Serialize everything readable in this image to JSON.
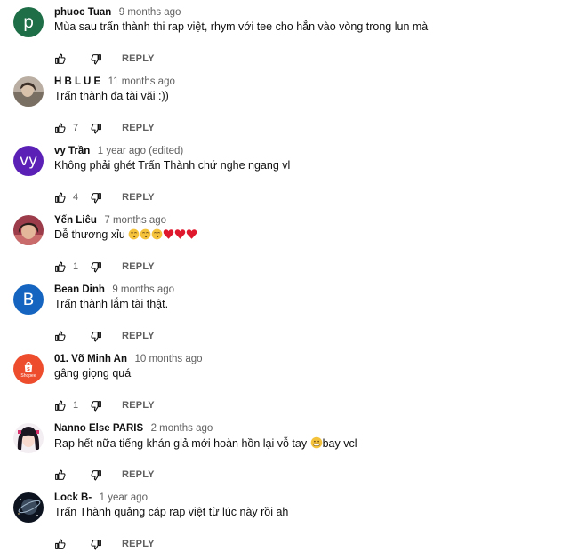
{
  "comments": [
    {
      "author": "phuoc Tuan",
      "time": "9 months ago",
      "text": "Mùa sau trấn thành thi rap việt, rhym với tee cho hẳn vào vòng trong lun mà",
      "likes": "",
      "reply_label": "REPLY",
      "avatar": {
        "type": "letter",
        "letter": "p",
        "color": "#1e6e47"
      }
    },
    {
      "author": "H B L U E",
      "time": "11 months ago",
      "text": "Trấn thành đa tài vãi :))",
      "likes": "7",
      "reply_label": "REPLY",
      "avatar": {
        "type": "photo",
        "icon": "person-photo-icon"
      }
    },
    {
      "author": "vy Trần",
      "time": "1 year ago (edited)",
      "text": "Không phải ghét Trấn Thành chứ nghe ngang vl",
      "likes": "4",
      "reply_label": "REPLY",
      "avatar": {
        "type": "letter",
        "letter": "vy",
        "color": "#5b21b6"
      }
    },
    {
      "author": "Yến Liêu",
      "time": "7 months ago",
      "text": "Dễ thương xỉu ",
      "emojis": [
        "kiss-emoji",
        "kiss-emoji",
        "kiss-emoji",
        "heart-emoji",
        "heart-emoji",
        "heart-emoji"
      ],
      "likes": "1",
      "reply_label": "REPLY",
      "avatar": {
        "type": "photo",
        "icon": "person-photo-icon"
      }
    },
    {
      "author": "Bean Dinh",
      "time": "9 months ago",
      "text": "Trấn thành lắm tài thật.",
      "likes": "",
      "reply_label": "REPLY",
      "avatar": {
        "type": "letter",
        "letter": "B",
        "color": "#1565c0"
      }
    },
    {
      "author": "01. Võ Minh An",
      "time": "10 months ago",
      "text": "gâng giọng quá",
      "likes": "1",
      "reply_label": "REPLY",
      "avatar": {
        "type": "shopee",
        "label": "Shopee",
        "color": "#ee4d2d"
      }
    },
    {
      "author": "Nanno Else PARIS",
      "time": "2 months ago",
      "text": "Rap hết nữa tiếng khán giả mới hoàn hồn lại vỗ tay ",
      "text_after": "bay vcl",
      "emojis": [
        "grimace-emoji"
      ],
      "likes": "",
      "reply_label": "REPLY",
      "avatar": {
        "type": "photo",
        "icon": "anime-avatar-icon"
      }
    },
    {
      "author": "Lock B-",
      "time": "1 year ago",
      "text": "Trấn Thành quảng cáp rap việt từ lúc này rồi ah",
      "likes": "",
      "reply_label": "REPLY",
      "avatar": {
        "type": "photo",
        "icon": "galaxy-avatar-icon"
      }
    }
  ]
}
